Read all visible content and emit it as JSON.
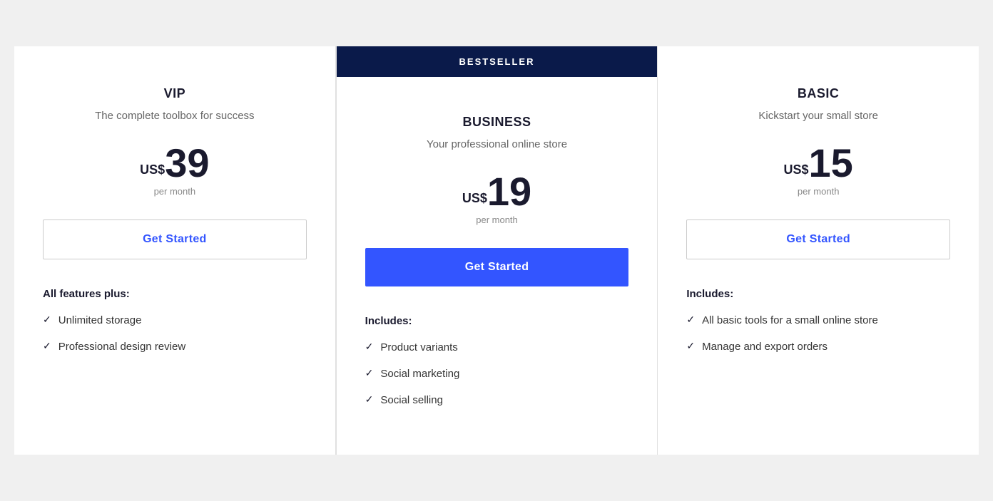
{
  "colors": {
    "dark_navy": "#0a1a4a",
    "white": "#ffffff",
    "blue_accent": "#3355ff",
    "text_dark": "#1a1a2e",
    "text_gray": "#666666",
    "text_light": "#888888",
    "bg": "#f0f0f0"
  },
  "plans": [
    {
      "id": "vip",
      "name": "VIP",
      "description": "The complete toolbox for success",
      "currency": "US$",
      "price": "39",
      "period": "per month",
      "cta_label": "Get Started",
      "cta_style": "outline",
      "bestseller": false,
      "features_heading": "All features plus:",
      "features": [
        "Unlimited storage",
        "Professional design review"
      ]
    },
    {
      "id": "business",
      "name": "BUSINESS",
      "description": "Your professional online store",
      "currency": "US$",
      "price": "19",
      "period": "per month",
      "cta_label": "Get Started",
      "cta_style": "filled",
      "bestseller": true,
      "bestseller_label": "BESTSELLER",
      "features_heading": "Includes:",
      "features": [
        "Product variants",
        "Social marketing",
        "Social selling"
      ]
    },
    {
      "id": "basic",
      "name": "BASIC",
      "description": "Kickstart your small store",
      "currency": "US$",
      "price": "15",
      "period": "per month",
      "cta_label": "Get Started",
      "cta_style": "outline",
      "bestseller": false,
      "features_heading": "Includes:",
      "features": [
        "All basic tools for a small online store",
        "Manage and export orders"
      ]
    }
  ]
}
